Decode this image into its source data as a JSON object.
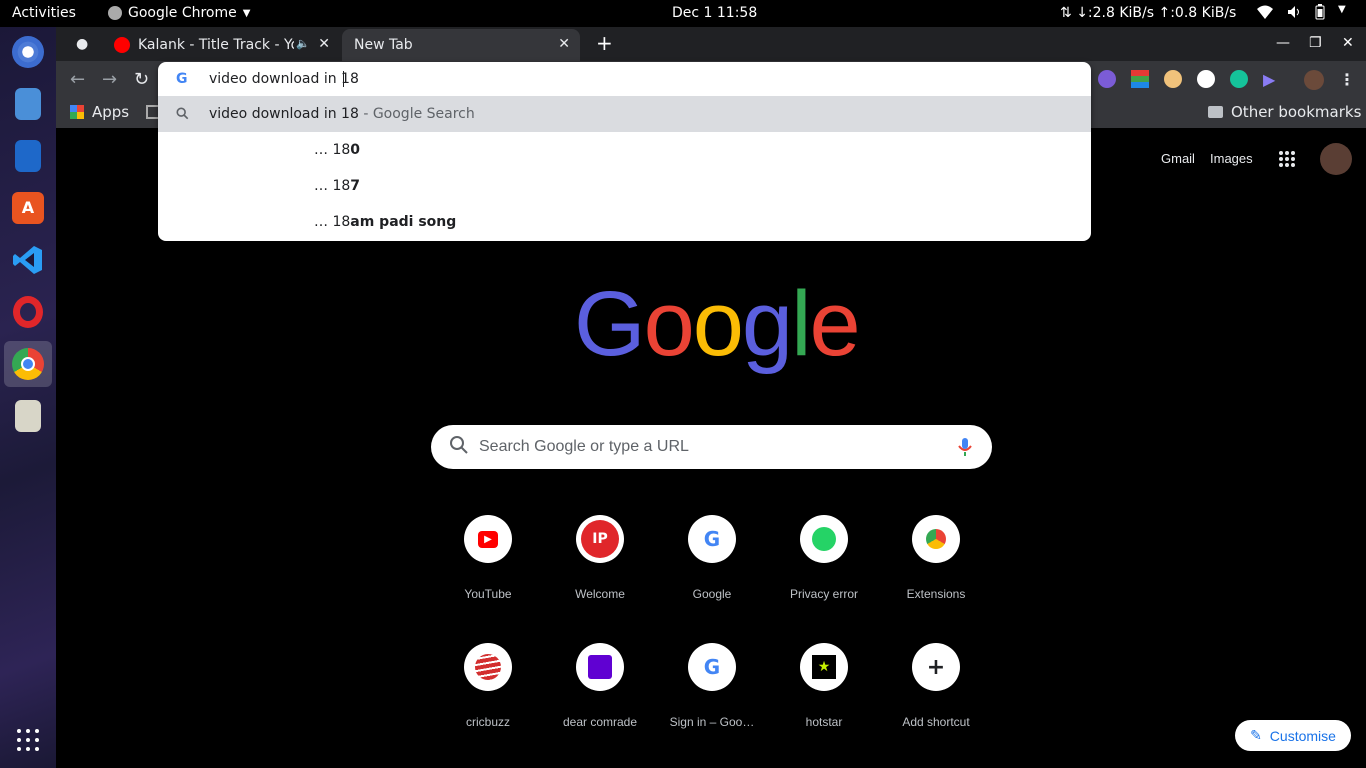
{
  "topbar": {
    "activities": "Activities",
    "app_name": "Google Chrome",
    "clock": "Dec 1  11:58",
    "net_speed": "↓:2.8 KiB/s ↑:0.8 KiB/s"
  },
  "dock": {
    "items": [
      "chromium-icon",
      "files-icon",
      "writer-icon",
      "software-store-icon",
      "vscode-icon",
      "opera-icon",
      "chrome-icon",
      "notes-icon"
    ]
  },
  "tabs": [
    {
      "title": "Kalank - Title Track - Yo",
      "active": false
    },
    {
      "title": "New Tab",
      "active": true
    }
  ],
  "omnibox": {
    "input_value": "video download in 18",
    "suggestions": [
      {
        "prefix": "video download in 18",
        "suffix": " - Google Search"
      },
      {
        "prefix": "… 18",
        "bold": "0"
      },
      {
        "prefix": "… 18",
        "bold": "7"
      },
      {
        "prefix": "… 18",
        "bold": "am padi song"
      }
    ]
  },
  "bookmarks": {
    "apps": "Apps",
    "other": "Other bookmarks"
  },
  "ntp": {
    "links": {
      "gmail": "Gmail",
      "images": "Images"
    },
    "search_placeholder": "Search Google or type a URL",
    "shortcuts_row1": [
      "YouTube",
      "Welcome",
      "Google",
      "Privacy error",
      "Extensions"
    ],
    "shortcuts_row2": [
      "cricbuzz",
      "dear comrade",
      "Sign in – Goo…",
      "hotstar",
      "Add shortcut"
    ],
    "customise": "Customise"
  },
  "colors": {
    "accent_blue": "#8ab4f8",
    "logo": [
      "#5b5fde",
      "#ea4335",
      "#fbbc05",
      "#5b5fde",
      "#34a853",
      "#ea4335"
    ]
  }
}
